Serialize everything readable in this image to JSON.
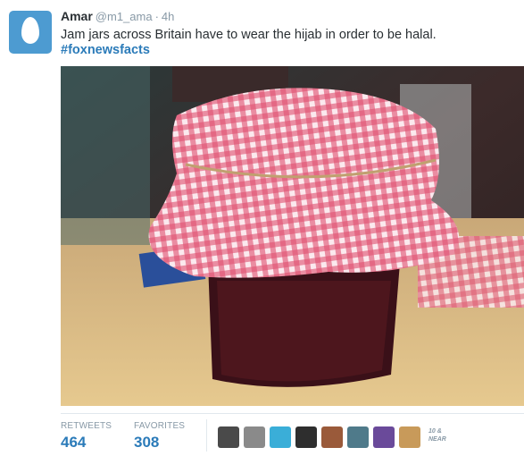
{
  "tweet": {
    "author": "Amar",
    "handle": "@m1_ama",
    "separator": "·",
    "time": "4h",
    "text": "Jam jars across Britain have to wear the hijab in order to be halal.",
    "hashtag": "#foxnewsfacts",
    "avatar_icon": "default-egg-avatar-icon",
    "avatar_color": "#4d9bd1"
  },
  "photo": {
    "icon": "jam-jar-gingham-photo"
  },
  "stats": {
    "retweets_label": "RETWEETS",
    "retweets_value": "464",
    "favorites_label": "FAVORITES",
    "favorites_value": "308"
  },
  "favoriters": {
    "more_label": "10 & NEAR",
    "avatars": [
      {
        "color": "#4a4a4a"
      },
      {
        "color": "#8a8a8a"
      },
      {
        "color": "#3aaed8"
      },
      {
        "color": "#2e2e2e"
      },
      {
        "color": "#9a5a3a"
      },
      {
        "color": "#4f7a8a"
      },
      {
        "color": "#6a4a9a"
      },
      {
        "color": "#c89a5a"
      }
    ]
  },
  "colors": {
    "link": "#2b7bb9",
    "muted": "#8899a6",
    "text": "#292f33"
  }
}
